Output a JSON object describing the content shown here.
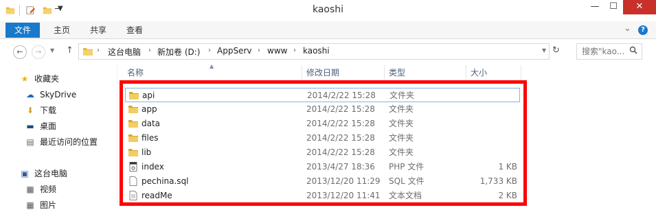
{
  "window": {
    "title": "kaoshi",
    "minimize": "—",
    "maximize": "☐",
    "close": "✕"
  },
  "ribbon": {
    "tabs": [
      {
        "label": "文件"
      },
      {
        "label": "主页"
      },
      {
        "label": "共享"
      },
      {
        "label": "查看"
      }
    ],
    "expand": "⌄",
    "help": "?"
  },
  "address": {
    "crumbs": [
      "这台电脑",
      "新加卷 (D:)",
      "AppServ",
      "www",
      "kaoshi"
    ],
    "search_placeholder": "搜索\"kao..."
  },
  "nav": {
    "favorites": "收藏夹",
    "skydrive": "SkyDrive",
    "downloads": "下载",
    "desktop": "桌面",
    "recent": "最近访问的位置",
    "thispc": "这台电脑",
    "videos": "视频",
    "pictures": "图片"
  },
  "columns": {
    "name": "名称",
    "date": "修改日期",
    "type": "类型",
    "size": "大小"
  },
  "files": [
    {
      "name": "api",
      "date": "2014/2/22 15:28",
      "type": "文件夹",
      "size": "",
      "icon": "folder-icon"
    },
    {
      "name": "app",
      "date": "2014/2/22 15:28",
      "type": "文件夹",
      "size": "",
      "icon": "folder-icon"
    },
    {
      "name": "data",
      "date": "2014/2/22 15:28",
      "type": "文件夹",
      "size": "",
      "icon": "folder-icon"
    },
    {
      "name": "files",
      "date": "2014/2/22 15:28",
      "type": "文件夹",
      "size": "",
      "icon": "folder-icon"
    },
    {
      "name": "lib",
      "date": "2014/2/22 15:28",
      "type": "文件夹",
      "size": "",
      "icon": "folder-icon"
    },
    {
      "name": "index",
      "date": "2013/4/27 18:36",
      "type": "PHP 文件",
      "size": "1 KB",
      "icon": "php-file-icon"
    },
    {
      "name": "pechina.sql",
      "date": "2013/12/20 11:29",
      "type": "SQL 文件",
      "size": "1,733 KB",
      "icon": "sql-file-icon"
    },
    {
      "name": "readMe",
      "date": "2013/12/20 11:41",
      "type": "文本文档",
      "size": "2 KB",
      "icon": "text-file-icon"
    }
  ],
  "colors": {
    "accent": "#1979ca",
    "highlight": "#ff0000",
    "close": "#c7312a"
  }
}
